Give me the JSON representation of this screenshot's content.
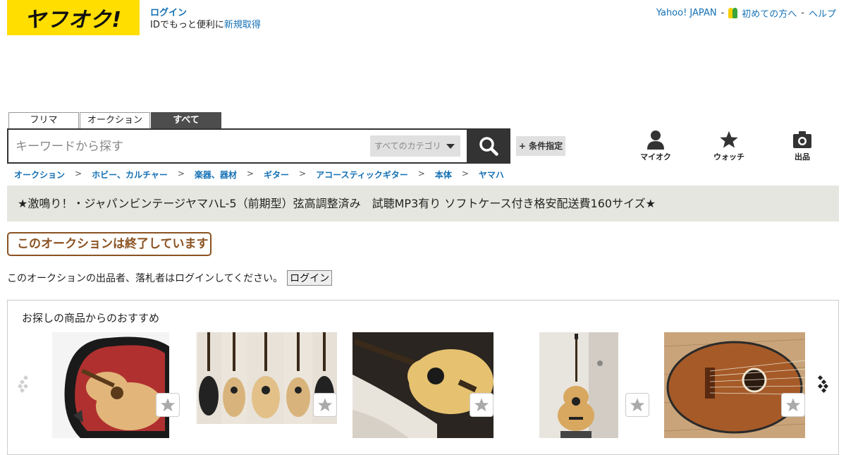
{
  "header": {
    "logo_text": "ヤフオク!",
    "login_label": "ログイン",
    "id_prompt": "IDでもっと便利に",
    "signup_label": "新規取得",
    "links": {
      "yahoo_japan": "Yahoo! JAPAN",
      "first_time": "初めての方へ",
      "help": "ヘルプ",
      "separator": "-"
    }
  },
  "search": {
    "tabs": [
      {
        "label": "フリマ",
        "active": false
      },
      {
        "label": "オークション",
        "active": false
      },
      {
        "label": "すべて",
        "active": true
      }
    ],
    "placeholder": "キーワードから探す",
    "category_selected": "すべてのカテゴリ",
    "conditions_label": "+ 条件指定"
  },
  "nav_icons": {
    "my_auction": "マイオク",
    "watch": "ウォッチ",
    "sell": "出品"
  },
  "breadcrumb": [
    "オークション",
    "ホビー、カルチャー",
    "楽器、器材",
    "ギター",
    "アコースティックギター",
    "本体",
    "ヤマハ"
  ],
  "breadcrumb_separator": ">",
  "item": {
    "title": "★激鳴り！・ジャパンビンテージヤマハL-5（前期型）弦高調整済み　試聴MP3有り ソフトケース付き格安配送費160サイズ★",
    "ended_badge": "このオークションは終了しています",
    "login_note": "このオークションの出品者、落札者はログインしてください。",
    "login_button": "ログイン"
  },
  "recommendations": {
    "title": "お探しの商品からのおすすめ",
    "items": [
      {
        "image": "acoustic guitar in open red-lined case"
      },
      {
        "image": "five acoustic guitars side by side"
      },
      {
        "image": "acoustic guitar on white sheet"
      },
      {
        "image": "acoustic guitar on stand by door"
      },
      {
        "image": "vintage parlor guitar on wood floor"
      }
    ]
  },
  "colors": {
    "brand_yellow": "#ffde00",
    "link_blue": "#1470b4",
    "ended_brown": "#8a5222",
    "title_bar_bg": "#e6e6e0"
  }
}
